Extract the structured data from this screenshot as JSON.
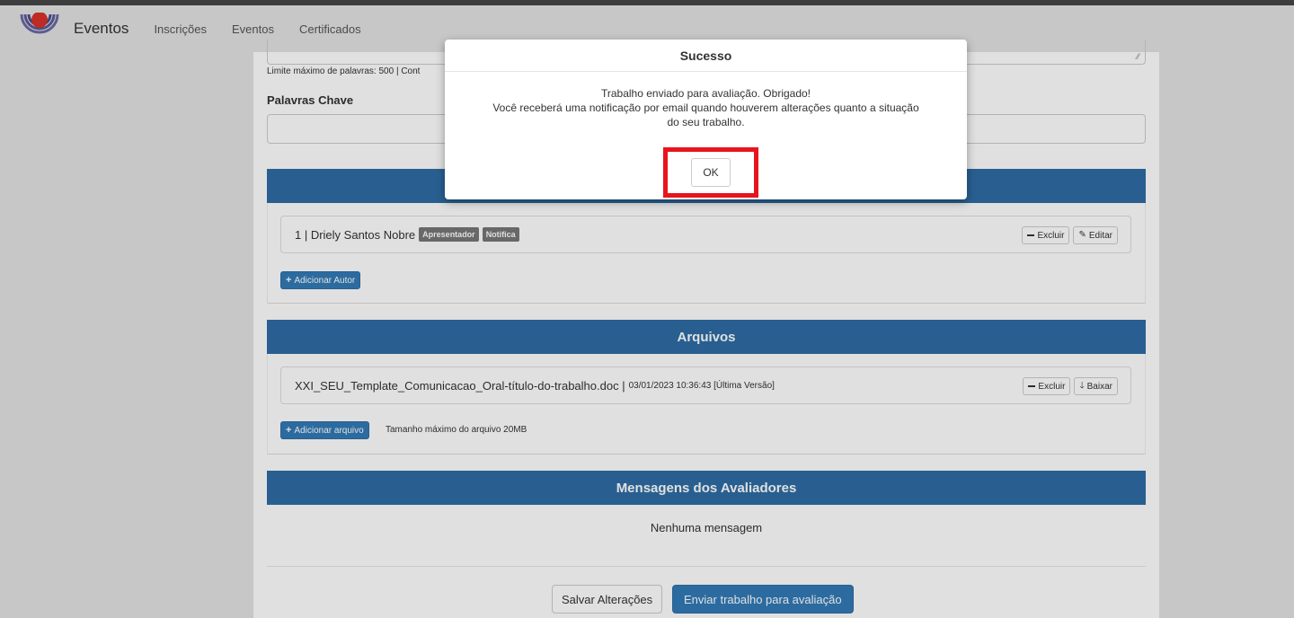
{
  "navbar": {
    "brand": "Eventos",
    "links": [
      "Inscrições",
      "Eventos",
      "Certificados"
    ]
  },
  "form": {
    "limit_text": "Limite máximo de palavras: 500 | Cont",
    "keywords_label": "Palavras Chave"
  },
  "authors": {
    "items": [
      {
        "text": "1 | Driely Santos Nobre",
        "badges": [
          "Apresentador",
          "Notifica"
        ]
      }
    ],
    "delete_label": "Excluir",
    "edit_label": "Editar",
    "add_label": "Adicionar Autor"
  },
  "files": {
    "title": "Arquivos",
    "items": [
      {
        "name": "XXI_SEU_Template_Comunicacao_Oral-título-do-trabalho.doc |",
        "meta": "03/01/2023 10:36:43 [Última Versão]"
      }
    ],
    "delete_label": "Excluir",
    "download_label": "Baixar",
    "add_label": "Adicionar arquivo",
    "size_note": "Tamanho máximo do arquivo 20MB"
  },
  "messages": {
    "title": "Mensagens dos Avaliadores",
    "empty": "Nenhuma mensagem"
  },
  "actions": {
    "save": "Salvar Alterações",
    "submit": "Enviar trabalho para avaliação"
  },
  "modal": {
    "title": "Sucesso",
    "line1": "Trabalho enviado para avaliação. Obrigado!",
    "line2": "Você receberá uma notificação por email quando houverem alterações quanto a situação",
    "line3": "do seu trabalho.",
    "ok": "OK"
  },
  "colors": {
    "primary": "#337ab7",
    "section_header": "#2e6da4",
    "highlight": "#e8141d",
    "badge": "#777777"
  }
}
